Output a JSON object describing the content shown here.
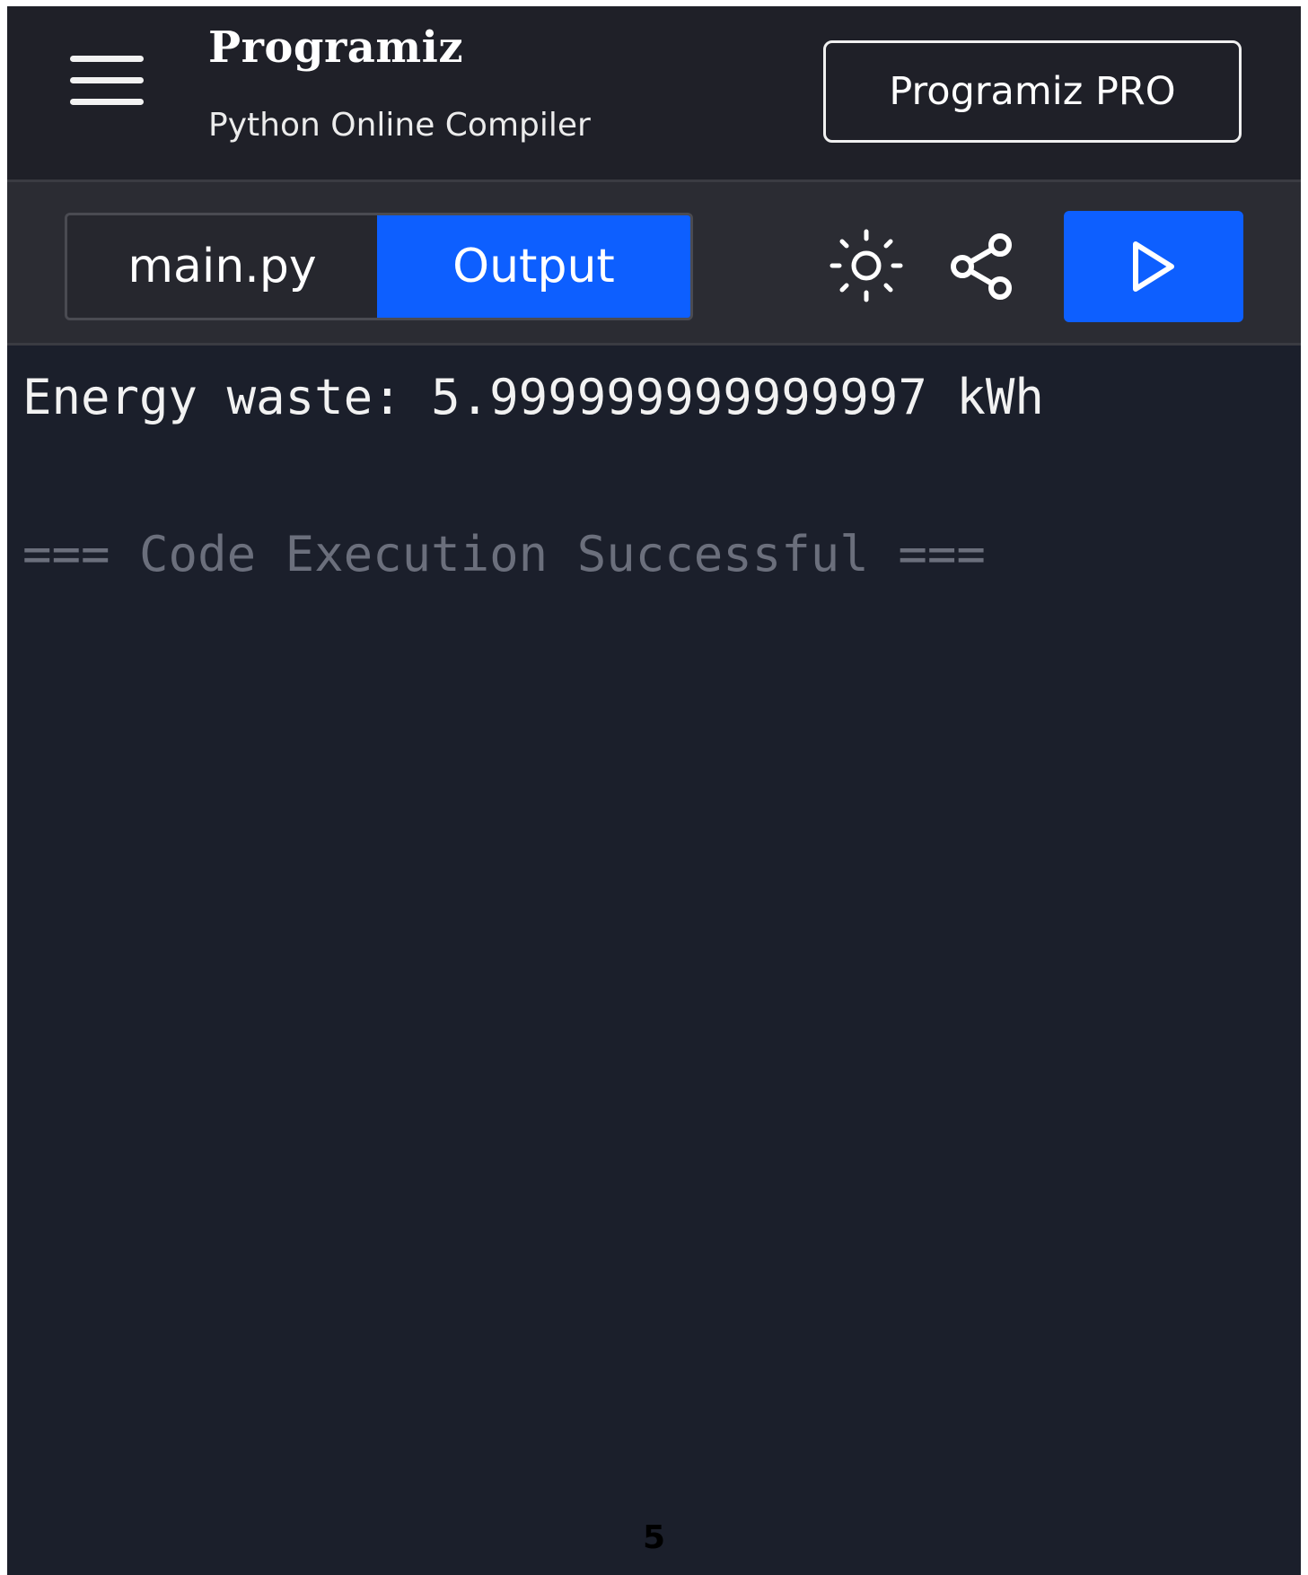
{
  "header": {
    "logo_text": "Programiz",
    "subtitle": "Python Online Compiler",
    "pro_button_label": "Programiz PRO"
  },
  "toolbar": {
    "tabs": [
      {
        "label": "main.py",
        "active": false
      },
      {
        "label": "Output",
        "active": true
      }
    ],
    "theme_icon": "sun-icon",
    "share_icon": "share-icon",
    "run_icon": "play-icon"
  },
  "output": {
    "result_line": "Energy waste: 5.999999999999997 kWh",
    "status_line": "=== Code Execution Successful ==="
  },
  "page_number": "5",
  "colors": {
    "accent": "#0d5fff",
    "header_bg": "#1f2028",
    "toolbar_bg": "#2b2c33",
    "output_bg": "#1b1f2b",
    "status_text": "#6b6f7c"
  }
}
